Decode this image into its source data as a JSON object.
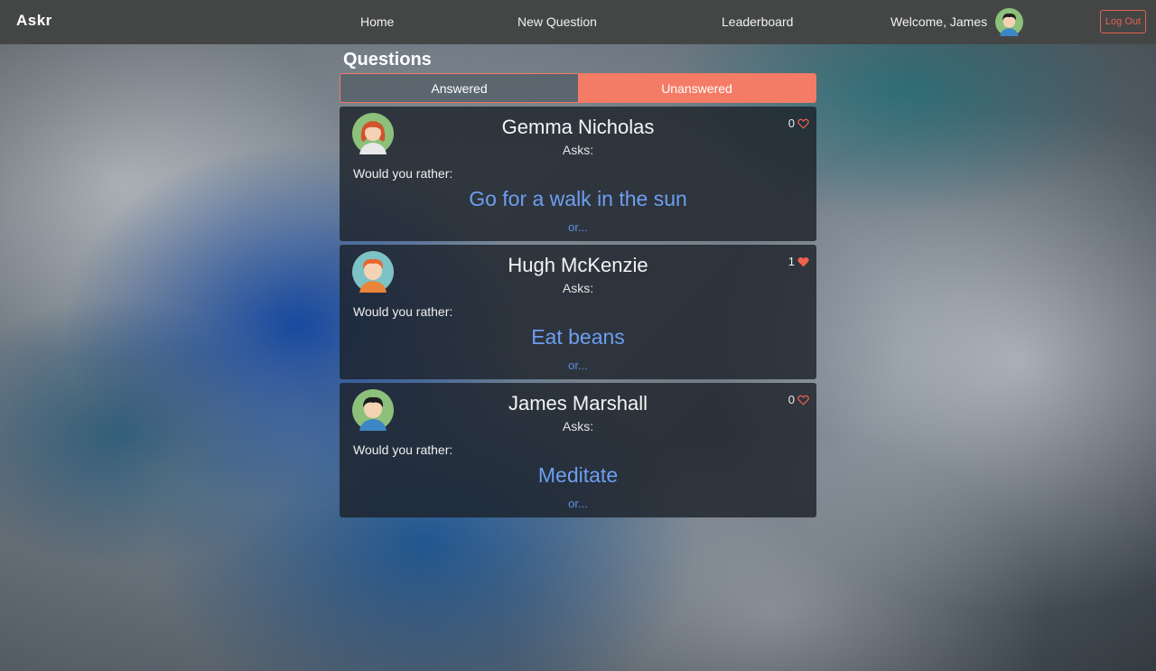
{
  "app": {
    "brand": "Askr"
  },
  "nav": {
    "home": "Home",
    "new_question": "New Question",
    "leaderboard": "Leaderboard",
    "welcome": "Welcome, James",
    "logout": "Log Out"
  },
  "page": {
    "title": "Questions"
  },
  "tabs": {
    "answered": "Answered",
    "unanswered": "Unanswered",
    "active": "Unanswered"
  },
  "colors": {
    "accent": "#f47c66",
    "option_link": "#6d9ef0",
    "navbar": "#444646"
  },
  "questions": [
    {
      "author": "Gemma Nicholas",
      "asks": "Asks:",
      "likes": "0",
      "liked": false,
      "prompt": "Would you rather:",
      "option": "Go for a walk in the sun",
      "or": "or..."
    },
    {
      "author": "Hugh McKenzie",
      "asks": "Asks:",
      "likes": "1",
      "liked": true,
      "prompt": "Would you rather:",
      "option": "Eat beans",
      "or": "or..."
    },
    {
      "author": "James Marshall",
      "asks": "Asks:",
      "likes": "0",
      "liked": false,
      "prompt": "Would you rather:",
      "option": "Meditate",
      "or": "or..."
    }
  ]
}
